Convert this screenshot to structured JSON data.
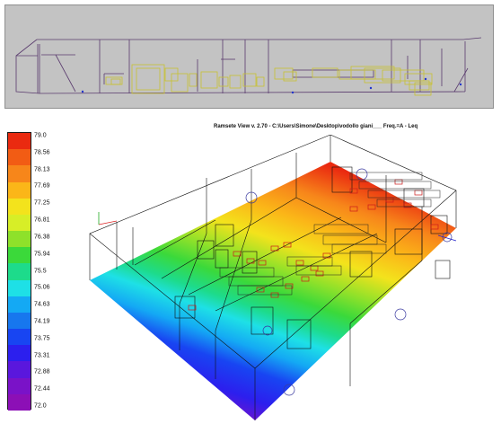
{
  "window": {
    "title": "Ramsete View v. 2.70 - C:\\Users\\Simone\\Desktop\\vodollo giani___ Freq.=A - Leq"
  },
  "legend": {
    "values": [
      "79.0",
      "78.56",
      "78.13",
      "77.69",
      "77.25",
      "76.81",
      "76.38",
      "75.94",
      "75.5",
      "75.06",
      "74.63",
      "74.19",
      "73.75",
      "73.31",
      "72.88",
      "72.44",
      "72.0"
    ],
    "colors": [
      "#ea2a10",
      "#f25c14",
      "#f7861a",
      "#fbb618",
      "#f3e31c",
      "#d7ee27",
      "#8ee12a",
      "#3bd93a",
      "#1ddb8b",
      "#1ee0e6",
      "#14a9f4",
      "#1777ee",
      "#1845f2",
      "#2c1fee",
      "#5a17dd",
      "#7a12c8",
      "#8c0fb6"
    ]
  },
  "colors": {
    "top_panel_bg": "#c3c3c3",
    "wire_dark": "#5a3b6e",
    "wire_yellow": "#c8c232",
    "receiver_blue": "#2033cc"
  }
}
